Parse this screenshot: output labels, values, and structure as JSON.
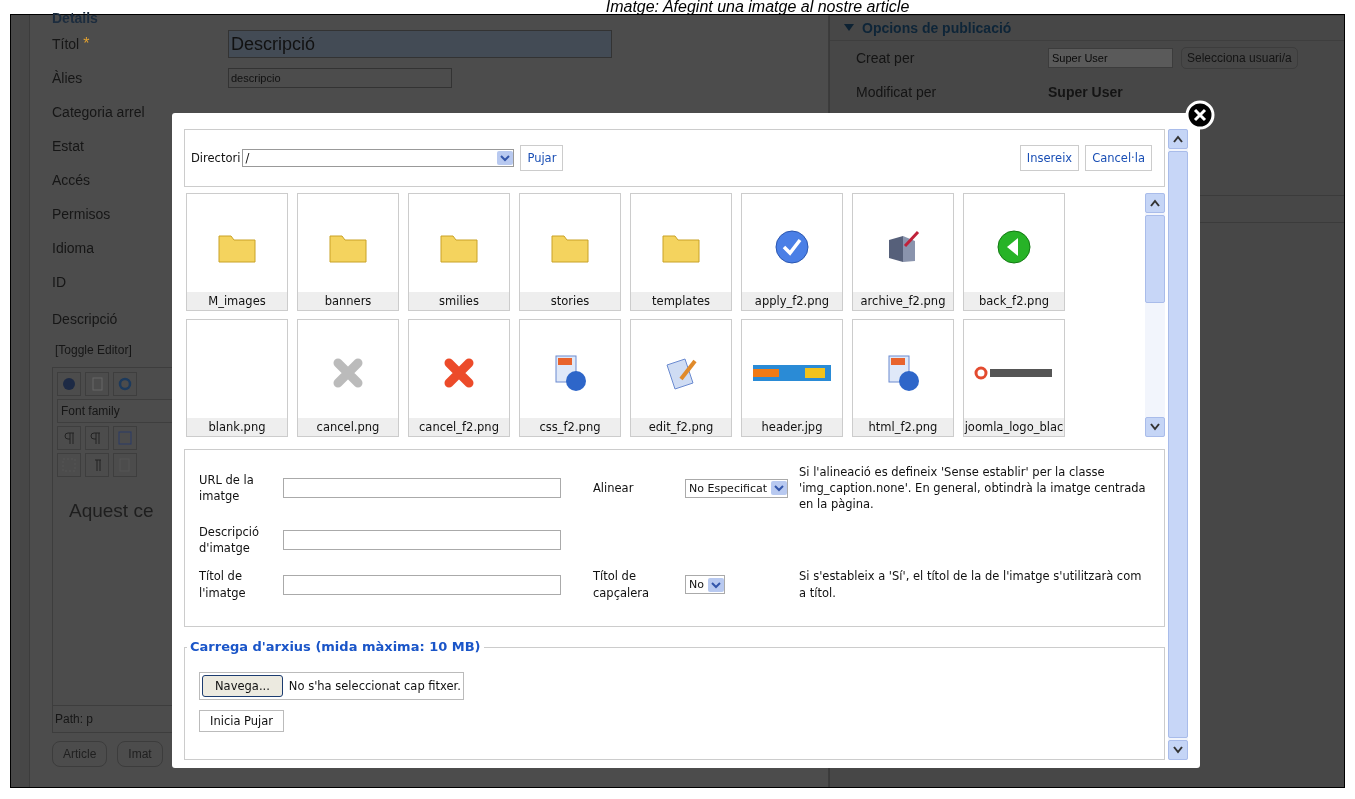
{
  "caption": "Imatge: Afegint una imatge al nostre article",
  "details": {
    "legend": "Details",
    "required_mark": "*",
    "fields": [
      {
        "label": "Títol",
        "required": true,
        "value": "Descripció",
        "kind": "big"
      },
      {
        "label": "Àlies",
        "required": false,
        "value": "descripcio",
        "kind": "small"
      },
      {
        "label": "Categoria arrel",
        "required": false
      },
      {
        "label": "Estat",
        "required": false
      },
      {
        "label": "Accés",
        "required": false
      },
      {
        "label": "Permisos",
        "required": false
      },
      {
        "label": "Idioma",
        "required": false
      },
      {
        "label": "ID",
        "required": false
      }
    ],
    "description_label": "Descripció",
    "toggle": "[Toggle Editor]",
    "font_select": "Font family",
    "editor_text": "Aquest ce",
    "path": "Path:  p",
    "buttons": [
      "Article",
      "Imat"
    ]
  },
  "publishing": {
    "title": "Opcions de publicació",
    "expanded": true,
    "created_label": "Creat per",
    "created_value": "Super User",
    "select_user": "Selecciona usuari/a",
    "modified_label": "Modificat per",
    "modified_value": "Super User"
  },
  "modal": {
    "directory_label": "Directori",
    "directory_value": "/",
    "upload_button": "Pujar",
    "insert_button": "Insereix",
    "cancel_button": "Cancel·la",
    "files": [
      {
        "name": "M_images",
        "kind": "folder"
      },
      {
        "name": "banners",
        "kind": "folder"
      },
      {
        "name": "smilies",
        "kind": "folder"
      },
      {
        "name": "stories",
        "kind": "folder"
      },
      {
        "name": "templates",
        "kind": "folder"
      },
      {
        "name": "apply_f2.png",
        "kind": "check"
      },
      {
        "name": "archive_f2.png",
        "kind": "archive"
      },
      {
        "name": "back_f2.png",
        "kind": "back"
      },
      {
        "name": "blank.png",
        "kind": "blank"
      },
      {
        "name": "cancel.png",
        "kind": "cross-muted"
      },
      {
        "name": "cancel_f2.png",
        "kind": "cross"
      },
      {
        "name": "css_f2.png",
        "kind": "doc-globe"
      },
      {
        "name": "edit_f2.png",
        "kind": "edit"
      },
      {
        "name": "header.jpg",
        "kind": "banner"
      },
      {
        "name": "html_f2.png",
        "kind": "doc-globe"
      },
      {
        "name": "joomla_logo_blac",
        "kind": "logo"
      }
    ],
    "url_label": "URL de la imatge",
    "align_label": "Alinear",
    "align_value": "No Especificat",
    "align_help": "Si l'alineació es defineix 'Sense establir' per la classe 'img_caption.none'. En general, obtindrà la imatge centrada en la pàgina.",
    "desc_label": "Descripció d'imatge",
    "title_label": "Títol de l'imatge",
    "caption_label": "Títol de capçalera",
    "caption_value": "No",
    "caption_help": "Si s'estableix a 'Sí', el títol de la de l'imatge s'utilitzarà com a títol.",
    "upload_legend": "Carrega d'arxius (mida màxima: 10 MB)",
    "browse_button": "Navega...",
    "no_file": "No s'ha seleccionat cap fitxer.",
    "start_upload": "Inicia Pujar"
  }
}
